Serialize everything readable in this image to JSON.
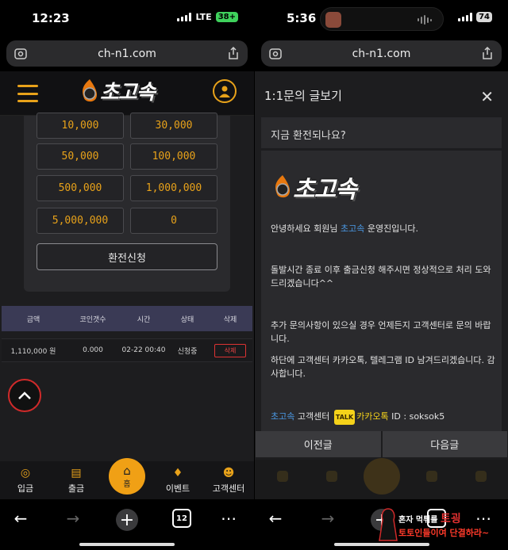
{
  "left": {
    "status": {
      "time": "12:23",
      "network": "LTE",
      "battery": "38+"
    },
    "browser": {
      "url": "ch-n1.com",
      "tab_count": "12"
    },
    "site": {
      "logo_text": "초고속"
    },
    "amount_buttons": [
      "10,000",
      "30,000",
      "50,000",
      "100,000",
      "500,000",
      "1,000,000",
      "5,000,000",
      "0"
    ],
    "exchange_button": "환전신청",
    "table": {
      "headers": [
        "금액",
        "코인갯수",
        "시간",
        "상태",
        "삭제"
      ],
      "rows": [
        {
          "amount": "1,110,000 원",
          "coins": "0.000",
          "time": "02-22 00:40",
          "status": "신청중",
          "delete": "삭제"
        }
      ]
    },
    "bottom_nav": [
      {
        "label": "입금",
        "icon": "coins-icon"
      },
      {
        "label": "출금",
        "icon": "withdraw-icon"
      },
      {
        "label": "홈",
        "icon": "home-icon"
      },
      {
        "label": "이벤트",
        "icon": "gift-icon"
      },
      {
        "label": "고객센터",
        "icon": "support-icon"
      }
    ]
  },
  "right": {
    "status": {
      "time": "5:36",
      "battery": "74"
    },
    "browser": {
      "url": "ch-n1.com"
    },
    "modal": {
      "title": "1:1문의 글보기",
      "subject": "지금 환전되나요?",
      "logo_text": "초고속",
      "greeting_prefix": "안녕하세요 회원님 ",
      "greeting_name": "초고속",
      "greeting_suffix": " 운영진입니다.",
      "para1": "돌발시간 종료 이후 출금신청 해주시면 정상적으로 처리 도와드리겠습니다^^",
      "para2": "추가 문의사항이 있으실 경우 언제든지 고객센터로 문의 바랍니다.",
      "para3": "하단에 고객센터 카카오톡, 텔레그램 ID 남겨드리겠습니다. 감사합니다.",
      "contact_brand": "초고속",
      "contact_label": " 고객센터 ",
      "kakao_badge": "TALK",
      "kakao_text": "카카오톡",
      "contact_id": " ID : soksok5",
      "prev_button": "이전글",
      "next_button": "다음글"
    }
  },
  "watermark": {
    "line1_a": "혼자 먹튀를",
    "line1_b": "토굉",
    "line2": "토토인들이여 단결하라~"
  },
  "colors": {
    "accent": "#e8a21a",
    "link": "#4b9be8",
    "delete": "#dd3333",
    "kakao": "#f5d21a"
  }
}
